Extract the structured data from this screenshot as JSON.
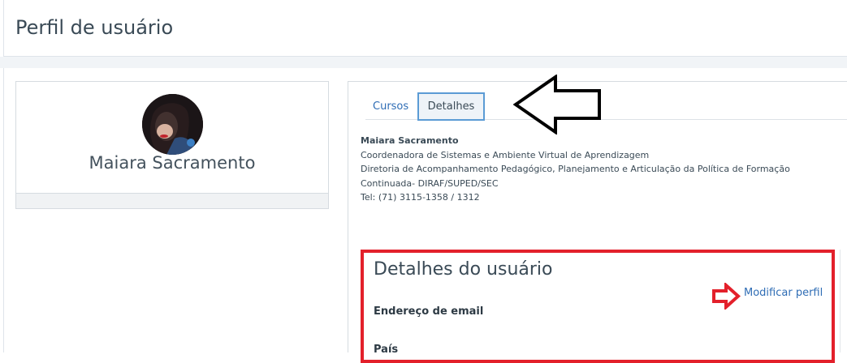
{
  "header": {
    "title": "Perfil de usuário"
  },
  "profile": {
    "name": "Maiara Sacramento"
  },
  "tabs": [
    {
      "label": "Cursos",
      "active": false
    },
    {
      "label": "Detalhes",
      "active": true
    }
  ],
  "bio": {
    "name": "Maiara Sacramento",
    "line1": "Coordenadora de Sistemas e Ambiente Virtual de Aprendizagem",
    "line2": "Diretoria de Acompanhamento Pedagógico, Planejamento e Articulação da Política de Formação",
    "line3": "Continuada- DIRAF/SUPED/SEC",
    "line4": "Tel: (71) 3115-1358 / 1312"
  },
  "details": {
    "title": "Detalhes do usuário",
    "edit_link": "Modificar perfil",
    "email_label": "Endereço de email",
    "country_label": "País"
  },
  "colors": {
    "accent": "#2f6db5",
    "highlight_box": "#e3202b",
    "active_tab_border": "#5b9bd5"
  },
  "icons": {
    "tab_pointer_arrow": "left-arrow-outline-icon",
    "edit_pointer_arrow": "right-arrow-outline-icon"
  }
}
